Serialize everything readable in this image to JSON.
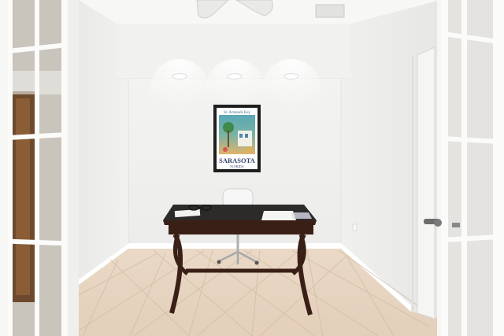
{
  "photo": {
    "poster": {
      "top_text": "St. Armands Key",
      "title": "SARASOTA",
      "subtitle": "FLORIDA"
    }
  },
  "colors": {
    "wall": "#f2f2f0",
    "ceiling": "#f6f6f4",
    "floor_tile": "#e6d6c4",
    "desk_wood": "#3a1f17",
    "desk_glass": "#2d2a2a"
  }
}
